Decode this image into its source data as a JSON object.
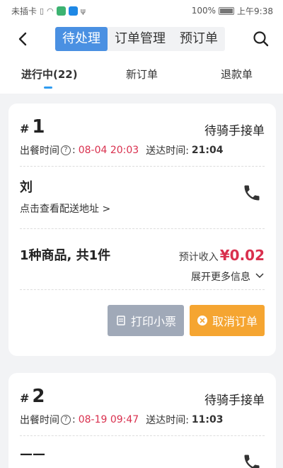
{
  "status_bar": {
    "carrier": "未插卡",
    "battery": "100%",
    "time": "上午9:38"
  },
  "nav": {
    "segments": [
      {
        "label": "待处理",
        "active": true
      },
      {
        "label": "订单管理",
        "active": false
      },
      {
        "label": "预订单",
        "active": false
      }
    ]
  },
  "tabs": [
    {
      "label": "进行中(22)",
      "active": true
    },
    {
      "label": "新订单",
      "active": false
    },
    {
      "label": "退款单",
      "active": false
    }
  ],
  "orders": [
    {
      "hash": "#",
      "number": "1",
      "status": "待骑手接单",
      "meal_label": "出餐时间",
      "meal_time": "08-04 20:03",
      "deliver_label": "送达时间:",
      "deliver_time": "21:04",
      "customer": "刘",
      "address_link": "点击查看配送地址 >",
      "goods": "1种商品, 共1件",
      "income_label": "预计收入",
      "income_value": "¥0.02",
      "expand_label": "展开更多信息",
      "print_label": "打印小票",
      "cancel_label": "取消订单"
    },
    {
      "hash": "#",
      "number": "2",
      "status": "待骑手接单",
      "meal_label": "出餐时间",
      "meal_time": "08-19 09:47",
      "deliver_label": "送达时间:",
      "deliver_time": "11:03",
      "customer": "——"
    }
  ],
  "colors": {
    "accent": "#4a90e2",
    "price_red": "#d9304e",
    "cancel_orange": "#f5a531",
    "print_gray": "#a0a9b8"
  }
}
